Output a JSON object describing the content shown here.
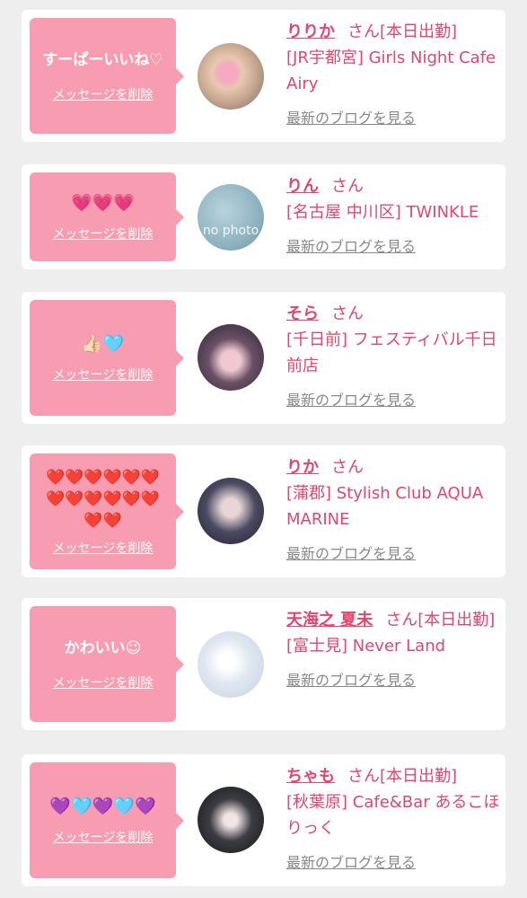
{
  "colors": {
    "page_bg": "#eeeeee",
    "card_bg": "#ffffff",
    "bubble_bg": "#f89db1",
    "accent_text": "#e0466e",
    "link_gray": "#888888"
  },
  "delete_label": "メッセージを削除",
  "blog_label": "最新のブログを見る",
  "san_suffix": "さん",
  "items": [
    {
      "message": "すーぱーいいね♡",
      "emoji": "",
      "name": "りりか",
      "san_status": "さん[本日出勤]",
      "shop": "[JR宇都宮] Girls Night Cafe Airy"
    },
    {
      "message": "",
      "emoji": "💗💗💗",
      "name": "りん",
      "san_status": "さん",
      "shop": "[名古屋 中川区] TWINKLE",
      "avatar_text": "no photo"
    },
    {
      "message": "",
      "emoji": "👍🏻🩵",
      "name": "そら",
      "san_status": "さん",
      "shop": "[千日前] フェスティバル千日前店"
    },
    {
      "message": "",
      "emoji": "❤️❤️❤️❤️❤️❤️❤️❤️❤️❤️❤️❤️❤️❤️",
      "name": "りか",
      "san_status": "さん",
      "shop": "[蒲郡] Stylish Club AQUA MARINE"
    },
    {
      "message": "かわいい☺",
      "emoji": "",
      "name": "天海之 夏未",
      "san_status": "さん[本日出勤]",
      "shop": "[富士見] Never Land"
    },
    {
      "message": "",
      "emoji": "💜🩵💜🩵💜",
      "name": "ちゃも",
      "san_status": "さん[本日出勤]",
      "shop": "[秋葉原] Cafe&Bar あるこほりっく"
    }
  ]
}
